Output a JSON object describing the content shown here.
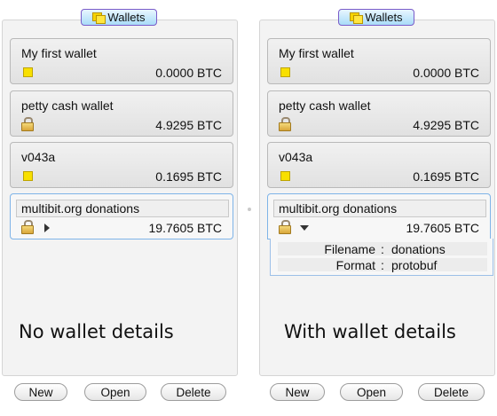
{
  "panels": [
    {
      "title": "Wallets",
      "wallets": [
        {
          "name": "My first wallet",
          "amount": "0.0000 BTC",
          "icon": "coin-icon"
        },
        {
          "name": "petty cash wallet",
          "amount": "4.9295 BTC",
          "icon": "lock-icon"
        },
        {
          "name": "v043a",
          "amount": "0.1695 BTC",
          "icon": "coin-icon"
        },
        {
          "name": "multibit.org donations",
          "amount": "19.7605 BTC",
          "icon": "lock-icon",
          "selected": true,
          "expand_icon": "disclosure-right-icon"
        }
      ],
      "caption": "No wallet details",
      "buttons": [
        "New",
        "Open",
        "Delete"
      ]
    },
    {
      "title": "Wallets",
      "wallets": [
        {
          "name": "My first wallet",
          "amount": "0.0000 BTC",
          "icon": "coin-icon"
        },
        {
          "name": "petty cash wallet",
          "amount": "4.9295 BTC",
          "icon": "lock-icon"
        },
        {
          "name": "v043a",
          "amount": "0.1695 BTC",
          "icon": "coin-icon"
        },
        {
          "name": "multibit.org donations",
          "amount": "19.7605 BTC",
          "icon": "lock-icon",
          "selected": true,
          "expand_icon": "disclosure-down-icon"
        }
      ],
      "details": [
        {
          "label": "Filename",
          "separator": ":",
          "value": "donations"
        },
        {
          "label": "Format",
          "separator": ":",
          "value": "protobuf"
        }
      ],
      "caption": "With wallet details",
      "buttons": [
        "New",
        "Open",
        "Delete"
      ]
    }
  ],
  "colors": {
    "selection_border": "#7fb4e8",
    "title_tab_border": "#7a5cc9",
    "coin": "#f8e000"
  }
}
